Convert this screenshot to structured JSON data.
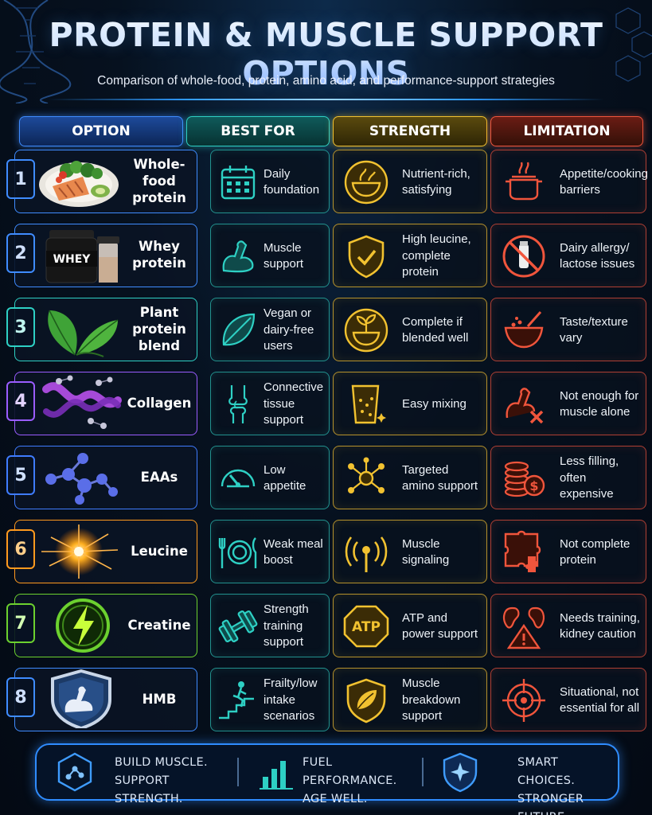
{
  "header": {
    "title": "PROTEIN & MUSCLE SUPPORT OPTIONS",
    "subtitle": "Comparison of whole-food, protein, amino acid, and performance-support strategies"
  },
  "columns": [
    "OPTION",
    "BEST FOR",
    "STRENGTH",
    "LIMITATION"
  ],
  "colors": {
    "option": "#3f8cff",
    "best_for": "#2ed0c4",
    "strength": "#f2c230",
    "limitation": "#f0553c"
  },
  "rows": [
    {
      "num": "1",
      "option": "Whole-food protein",
      "option_line1": "Whole-food",
      "option_line2": "protein",
      "best_for": "Daily foundation",
      "strength": "Nutrient-rich, satisfying",
      "limitation": "Appetite/cooking barriers",
      "accent": "#3f8cff",
      "image": "salmon-plate",
      "best_icon": "calendar-icon",
      "strength_icon": "food-bowl-icon",
      "limit_icon": "cooking-pot-icon"
    },
    {
      "num": "2",
      "option": "Whey protein",
      "option_line1": "Whey",
      "option_line2": "protein",
      "image_label": "WHEY",
      "best_for": "Muscle support",
      "strength": "High leucine, complete protein",
      "limitation": "Dairy allergy/ lactose issues",
      "accent": "#3f8cff",
      "image": "whey-tub-shaker",
      "best_icon": "flexed-arm-icon",
      "strength_icon": "shield-check-icon",
      "limit_icon": "no-milk-icon"
    },
    {
      "num": "3",
      "option": "Plant protein blend",
      "option_line1": "Plant",
      "option_line2": "protein blend",
      "best_for": "Vegan or dairy-free users",
      "strength": "Complete if blended well",
      "limitation": "Taste/texture vary",
      "accent": "#2ed0c4",
      "image": "leaves",
      "best_icon": "leaf-icon",
      "strength_icon": "sprout-bowl-icon",
      "limit_icon": "mixing-bowl-icon"
    },
    {
      "num": "4",
      "option": "Collagen",
      "option_line1": "Collagen",
      "option_line2": "",
      "best_for": "Connective tissue support",
      "strength": "Easy mixing",
      "limitation": "Not enough for muscle alone",
      "accent": "#9a5cff",
      "image": "collagen-helix",
      "best_icon": "knee-joint-icon",
      "strength_icon": "glass-icon",
      "limit_icon": "arm-x-icon"
    },
    {
      "num": "5",
      "option": "EAAs",
      "option_line1": "EAAs",
      "option_line2": "",
      "best_for": "Low appetite",
      "strength": "Targeted amino support",
      "limitation": "Less filling, often expensive",
      "accent": "#3f7cff",
      "image": "molecule",
      "best_icon": "gauge-icon",
      "strength_icon": "network-icon",
      "limit_icon": "coins-icon"
    },
    {
      "num": "6",
      "option": "Leucine",
      "option_line1": "Leucine",
      "option_line2": "",
      "best_for": "Weak meal boost",
      "strength": "Muscle signaling",
      "limitation": "Not complete protein",
      "accent": "#ff9a1e",
      "image": "spark-burst",
      "best_icon": "plate-utensils-icon",
      "strength_icon": "signal-icon",
      "limit_icon": "puzzle-icon"
    },
    {
      "num": "7",
      "option": "Creatine",
      "option_line1": "Creatine",
      "option_line2": "",
      "best_for": "Strength training support",
      "strength": "ATP and power support",
      "limitation": "Needs training, kidney caution",
      "accent": "#6cd12f",
      "image": "lightning-circle",
      "strength_badge": "ATP",
      "best_icon": "dumbbell-icon",
      "strength_icon": "atp-badge-icon",
      "limit_icon": "kidney-warning-icon"
    },
    {
      "num": "8",
      "option": "HMB",
      "option_line1": "HMB",
      "option_line2": "",
      "best_for": "Frailty/low intake scenarios",
      "strength": "Muscle breakdown support",
      "limitation": "Situational, not essential for all",
      "accent": "#3f8cff",
      "image": "shield-arm",
      "best_icon": "stairs-climb-icon",
      "strength_icon": "shield-leaf-icon",
      "limit_icon": "target-icon"
    }
  ],
  "footer": [
    {
      "line1": "BUILD MUSCLE.",
      "line2": "SUPPORT STRENGTH.",
      "icon": "molecule-hex-icon"
    },
    {
      "line1": "FUEL PERFORMANCE.",
      "line2": "AGE WELL.",
      "icon": "bar-chart-icon"
    },
    {
      "line1": "SMART CHOICES.",
      "line2": "STRONGER FUTURE.",
      "icon": "shield-star-icon"
    }
  ]
}
